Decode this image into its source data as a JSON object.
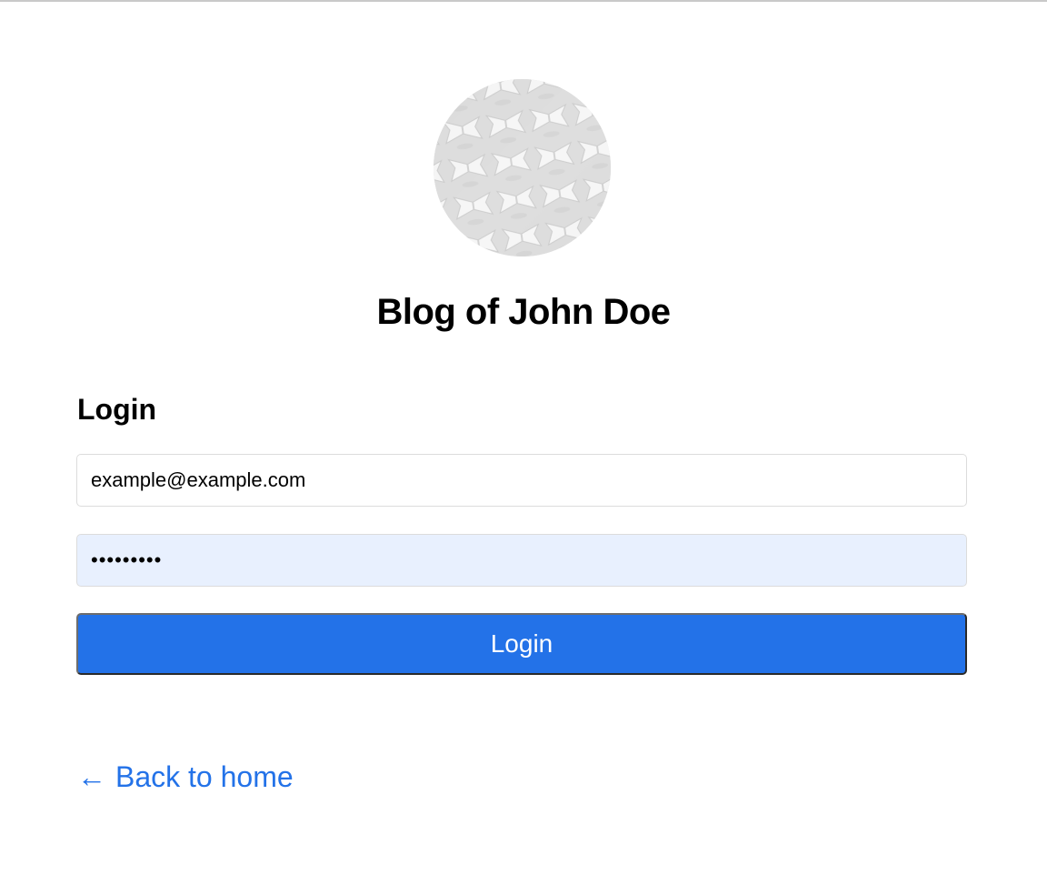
{
  "site": {
    "title": "Blog of John Doe",
    "avatar_icon": "woven-pattern-avatar"
  },
  "login": {
    "heading": "Login",
    "email_value": "example@example.com",
    "password_value": "•••••••••",
    "submit_label": "Login"
  },
  "footer": {
    "back_arrow": "←",
    "back_label": "Back to home"
  },
  "colors": {
    "accent": "#2372e8",
    "autofill_bg": "#e8f0fe",
    "border": "#dcdcdc"
  }
}
